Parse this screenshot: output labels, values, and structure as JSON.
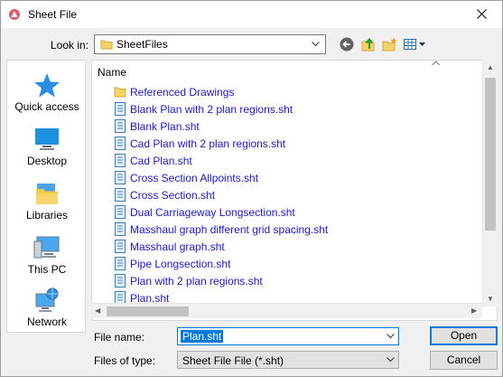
{
  "window": {
    "title": "Sheet File"
  },
  "lookin": {
    "label": "Look in:",
    "value": "SheetFiles"
  },
  "places": [
    {
      "label": "Quick access",
      "icon": "quick-access-star-icon"
    },
    {
      "label": "Desktop",
      "icon": "desktop-icon"
    },
    {
      "label": "Libraries",
      "icon": "libraries-icon"
    },
    {
      "label": "This PC",
      "icon": "this-pc-icon"
    },
    {
      "label": "Network",
      "icon": "network-icon"
    }
  ],
  "filelist": {
    "column": "Name",
    "items": [
      {
        "name": "Referenced Drawings",
        "type": "folder"
      },
      {
        "name": "Blank Plan with 2 plan regions.sht",
        "type": "file"
      },
      {
        "name": "Blank Plan.sht",
        "type": "file"
      },
      {
        "name": "Cad Plan with 2 plan regions.sht",
        "type": "file"
      },
      {
        "name": "Cad Plan.sht",
        "type": "file"
      },
      {
        "name": "Cross Section Allpoints.sht",
        "type": "file"
      },
      {
        "name": "Cross Section.sht",
        "type": "file"
      },
      {
        "name": "Dual Carriageway Longsection.sht",
        "type": "file"
      },
      {
        "name": "Masshaul graph different grid spacing.sht",
        "type": "file"
      },
      {
        "name": "Masshaul graph.sht",
        "type": "file"
      },
      {
        "name": "Pipe Longsection.sht",
        "type": "file"
      },
      {
        "name": "Plan with 2 plan regions.sht",
        "type": "file"
      },
      {
        "name": "Plan.sht",
        "type": "file"
      }
    ]
  },
  "form": {
    "filename_label": "File name:",
    "filename_value": "Plan.sht",
    "filetype_label": "Files of type:",
    "filetype_value": "Sheet File File (*.sht)"
  },
  "buttons": {
    "open": "Open",
    "cancel": "Cancel"
  },
  "colors": {
    "link_text": "#1a1acc",
    "accent": "#0078d7"
  }
}
